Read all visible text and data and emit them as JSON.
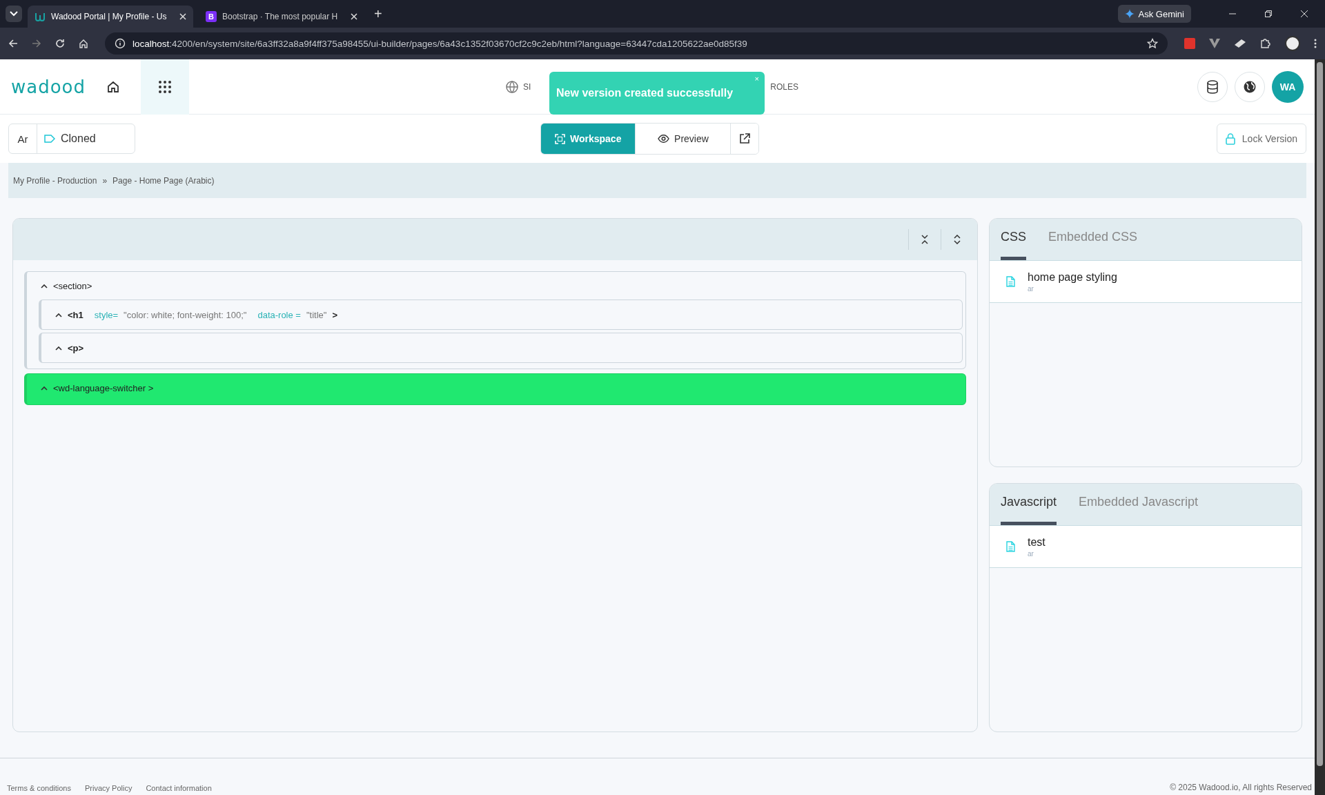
{
  "browser": {
    "tabs": [
      {
        "title": "Wadood Portal | My Profile - Us",
        "selected": true,
        "kind": "wadood"
      },
      {
        "title": "Bootstrap · The most popular H",
        "selected": false,
        "kind": "bootstrap"
      }
    ],
    "favicon_letter": "B",
    "new_tab": "+",
    "url_host": "localhost",
    "url_rest": ":4200/en/system/site/6a3ff32a8a9f4ff375a98455/ui-builder/pages/6a43c1352f03670cf2c9c2eb/html?language=63447cda1205622ae0d85f39",
    "ask_label": "Ask Gemini"
  },
  "header": {
    "logo": "wadood",
    "nav": [
      {
        "label": "SI"
      },
      {
        "label": "ROLES"
      }
    ],
    "toast": {
      "message": "New version created successfully",
      "close": "×"
    },
    "avatar": "WA"
  },
  "toolbar": {
    "language": "Ar",
    "status": "Cloned",
    "view_tabs": [
      {
        "label": "Workspace",
        "selected": true
      },
      {
        "label": "Preview",
        "selected": false
      }
    ],
    "lock_label": "Lock Version"
  },
  "breadcrumb": {
    "items": [
      "My Profile - Production",
      "Page - Home Page (Arabic)"
    ],
    "separator": "»"
  },
  "tree": [
    {
      "label": "<section>",
      "expanded": true,
      "highlighted": false,
      "children": [
        {
          "label": "<h1",
          "attributes": [
            {
              "name": "style=",
              "value": "\"color: white; font-weight: 100;\""
            },
            {
              "name": "data-role =",
              "value": "\"title\""
            }
          ],
          "end": ">",
          "expanded": true,
          "highlighted": false
        },
        {
          "label": "<p>",
          "expanded": true,
          "highlighted": false
        }
      ]
    },
    {
      "label": "<wd-language-switcher >",
      "expanded": true,
      "highlighted": true
    }
  ],
  "css_panel": {
    "tabs": [
      {
        "label": "CSS",
        "selected": true
      },
      {
        "label": "Embedded CSS",
        "selected": false
      }
    ],
    "files": [
      {
        "name": "home page styling",
        "language": "ar"
      }
    ]
  },
  "js_panel": {
    "tabs": [
      {
        "label": "Javascript",
        "selected": true
      },
      {
        "label": "Embedded Javascript",
        "selected": false
      }
    ],
    "files": [
      {
        "name": "test",
        "language": "ar"
      }
    ]
  },
  "footer": {
    "links": [
      "Terms & conditions",
      "Privacy Policy",
      "Contact information"
    ],
    "copyright": "© 2025 Wadood.io, All rights Reserved"
  }
}
